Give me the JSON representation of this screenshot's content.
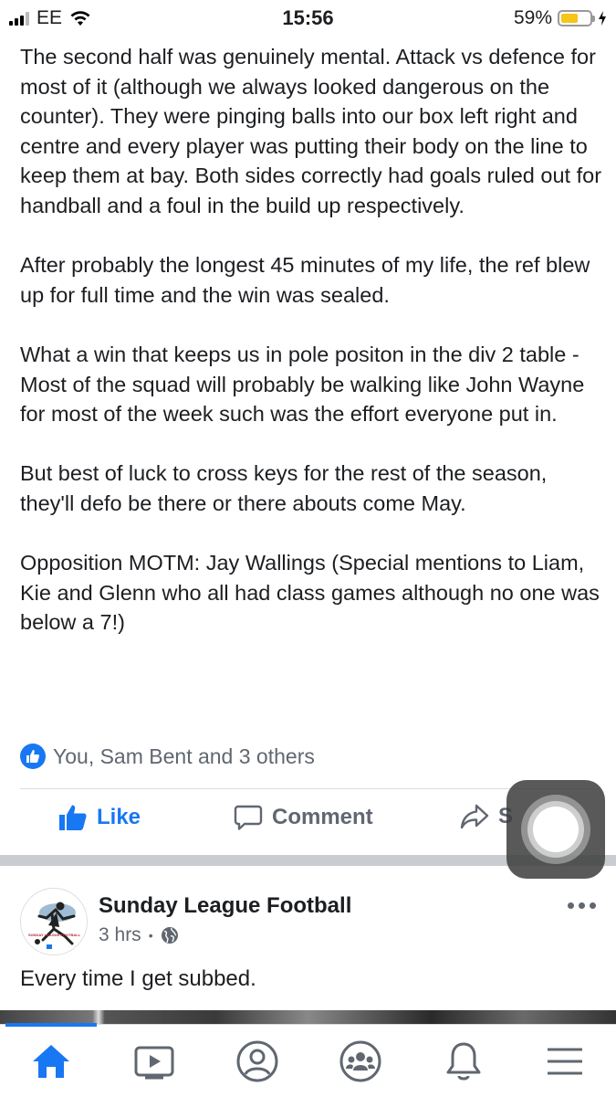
{
  "status_bar": {
    "carrier": "EE",
    "time": "15:56",
    "battery_percent": "59%",
    "battery_level": 0.59
  },
  "post": {
    "paragraphs": [
      "The second half was genuinely mental. Attack vs defence for most of it (although we always looked dangerous on the counter). They were pinging balls into our box left right and centre and every player was putting their body on the line to keep them at bay. Both sides correctly had goals ruled out for handball and a foul in the build up respectively.",
      "After probably the longest 45 minutes of my life, the ref blew up for full time and the win was sealed.",
      "What a win that keeps us in pole positon in the div 2 table - Most of the squad will probably be walking like John Wayne for most of the week such was the effort everyone put in.",
      "But best of luck to cross keys for the rest of the season, they'll defo be there or there abouts come May.",
      "Opposition MOTM: Jay Wallings (Special mentions to Liam, Kie and Glenn who all had class games although no one was below a 7!)"
    ],
    "reactions_text": "You, Sam Bent and 3 others",
    "actions": {
      "like": "Like",
      "comment": "Comment",
      "share": "S"
    }
  },
  "post2": {
    "page_name": "Sunday League Football",
    "time": "3 hrs",
    "text": "Every time I get subbed.",
    "avatar_text": "SUNDAY LEAGUE FOOTBALL"
  },
  "tabs": [
    "home-icon",
    "watch-icon",
    "profile-icon",
    "groups-icon",
    "notifications-icon",
    "menu-icon"
  ],
  "colors": {
    "accent": "#1877f2",
    "text": "#1c1e21",
    "secondary": "#606770"
  }
}
